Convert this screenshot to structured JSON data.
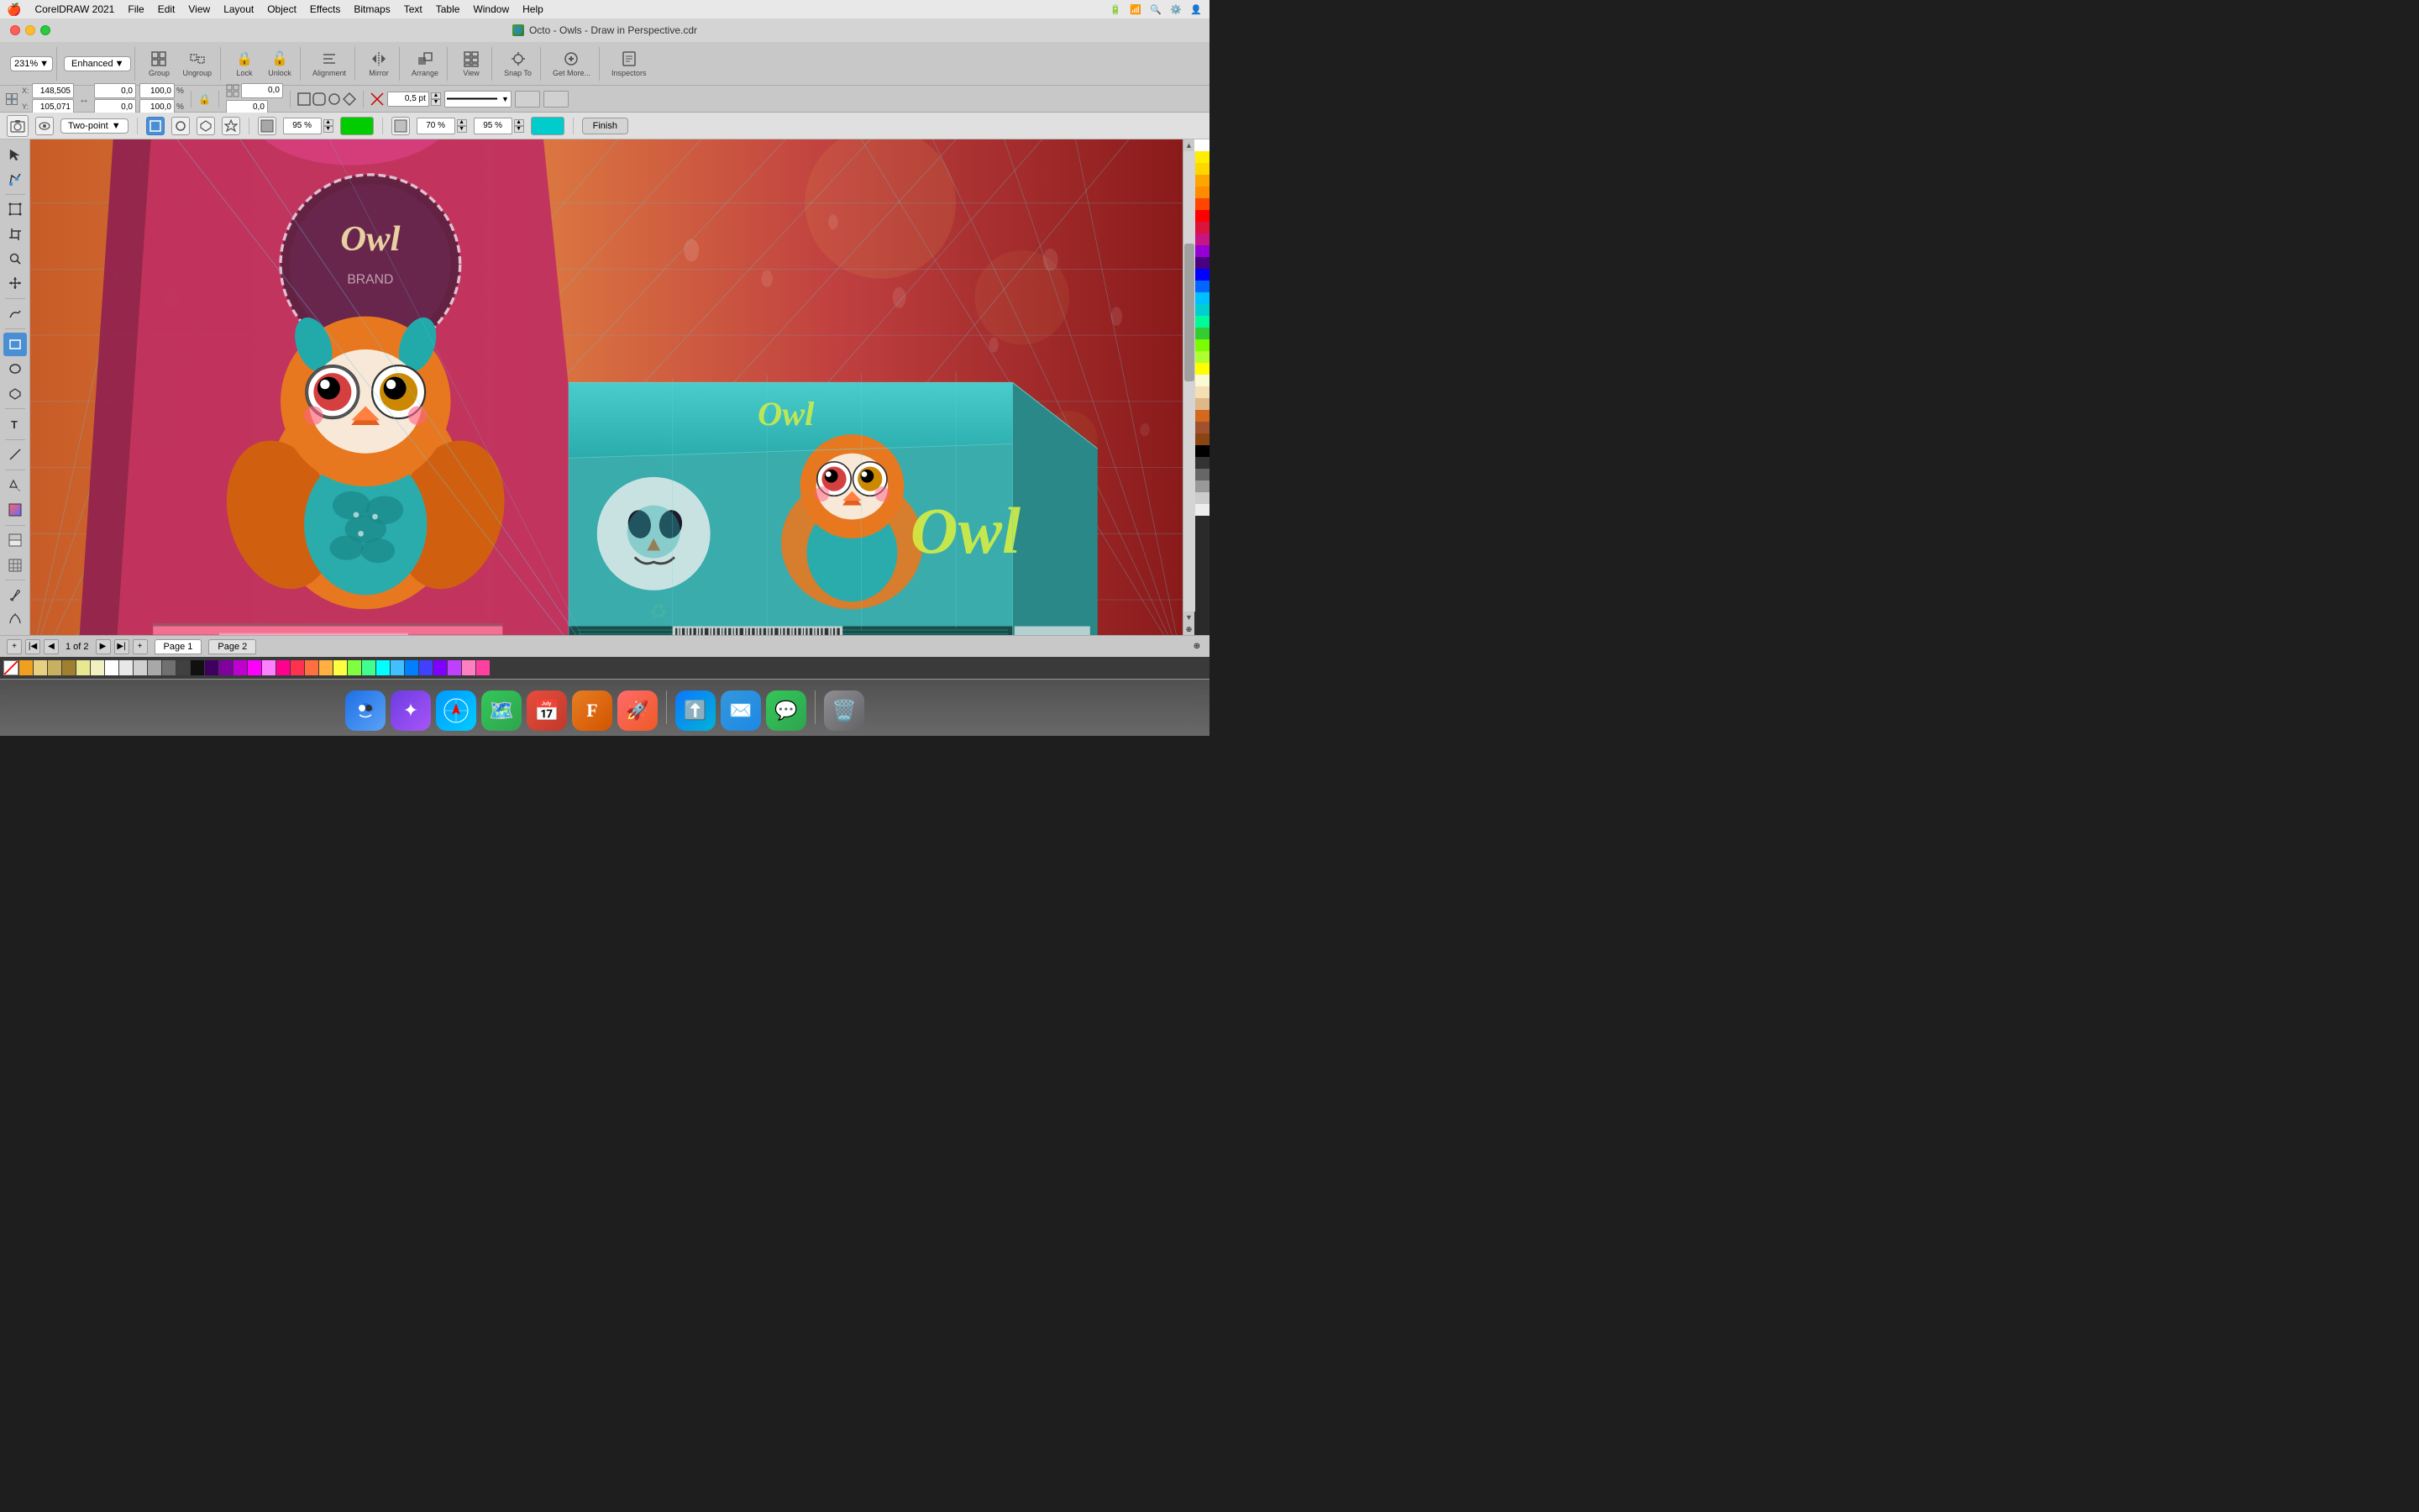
{
  "app": {
    "name": "CorelDRAW 2021",
    "title": "Octo - Owls - Draw in Perspective.cdr",
    "title_icon": "🦉"
  },
  "menubar": {
    "apple": "🍎",
    "items": [
      "CorelDRAW 2021",
      "File",
      "Edit",
      "View",
      "Layout",
      "Object",
      "Effects",
      "Bitmaps",
      "Text",
      "Table",
      "Window",
      "Help"
    ],
    "right_icons": [
      "battery",
      "wifi",
      "search",
      "control-center",
      "notification"
    ]
  },
  "toolbar": {
    "zoom_label": "231%",
    "view_mode_label": "Enhanced",
    "group_label": "Group",
    "ungroup_label": "Ungroup",
    "lock_label": "Lock",
    "unlock_label": "Unlock",
    "alignment_label": "Alignment",
    "mirror_label": "Mirror",
    "arrange_label": "Arrange",
    "view_label": "View",
    "snap_to_label": "Snap To",
    "get_more_label": "Get More...",
    "inspectors_label": "Inspectors"
  },
  "property_bar": {
    "x_value": "148,505",
    "y_value": "105,071",
    "x_label": "X:",
    "y_label": "Y:",
    "w_value": "0,0",
    "h_value": "0,0",
    "w_pct": "100,0",
    "h_pct": "100,0",
    "w_pct_sign": "%",
    "h_pct_sign": "%",
    "pos1": "0,0",
    "pos2": "0,0",
    "pos3": "0,0",
    "pos4": "0,0",
    "pos5": "0,0",
    "pos6": "0,0",
    "stroke_size": "0,5 pt",
    "angle": "0,0"
  },
  "perspective_bar": {
    "mode_label": "Two-point",
    "opacity1": "95 %",
    "opacity2": "70 %",
    "opacity3": "95 %",
    "finish_label": "Finish"
  },
  "canvas": {
    "background_color": "#c94040"
  },
  "status_bar": {
    "page_info": "1 of 2",
    "page1_label": "Page 1",
    "page2_label": "Page 2"
  },
  "color_palette": {
    "colors": [
      "#ffffff",
      "#ffee00",
      "#ffd700",
      "#ffa500",
      "#ff8c00",
      "#ff4500",
      "#ff0000",
      "#dc143c",
      "#c71585",
      "#9400d3",
      "#4b0082",
      "#0000ff",
      "#0066ff",
      "#00bfff",
      "#00ced1",
      "#00fa9a",
      "#32cd32",
      "#7cfc00",
      "#adff2f",
      "#ffff00",
      "#fafad2",
      "#f5deb3",
      "#deb887",
      "#d2691e",
      "#a0522d",
      "#8b4513",
      "#000000",
      "#333333",
      "#666666",
      "#999999",
      "#cccccc",
      "#eeeeee"
    ]
  },
  "bottom_colors": [
    "#f0a020",
    "#d4b060",
    "#c8a050",
    "#a06830",
    "#e0e0a0",
    "#f0f0d0",
    "#ffffff",
    "#e0e0e0",
    "#c0c0c0",
    "#909090",
    "#606060",
    "#303030",
    "#000000",
    "#400040",
    "#800080",
    "#c000c0",
    "#ff00ff",
    "#ff80ff",
    "#ff0080",
    "#ff4040",
    "#ff8040",
    "#ffc040",
    "#ffff40",
    "#80ff40",
    "#40ff80",
    "#00ffff",
    "#40c0ff",
    "#0080ff",
    "#4040ff",
    "#8000ff",
    "#c040ff"
  ],
  "dock": {
    "items": [
      {
        "name": "finder",
        "icon": "🔵",
        "color": "#1d6fe7"
      },
      {
        "name": "siri",
        "icon": "🔮",
        "color": "#9b59b6"
      },
      {
        "name": "safari",
        "icon": "🧭",
        "color": "#1a9af7"
      },
      {
        "name": "maps",
        "icon": "🗺️",
        "color": "#34c759"
      },
      {
        "name": "fantastical",
        "icon": "📅",
        "color": "#e74c3c"
      },
      {
        "name": "fontbook",
        "icon": "Ⓕ",
        "color": "#e67e22"
      },
      {
        "name": "launchpad",
        "icon": "🚀",
        "color": "#ff6b6b"
      },
      {
        "name": "appstore",
        "icon": "⬆️",
        "color": "#1778f2"
      },
      {
        "name": "mail",
        "icon": "✉️",
        "color": "#3498db"
      },
      {
        "name": "messages",
        "icon": "💬",
        "color": "#34c759"
      },
      {
        "name": "trash",
        "icon": "🗑️",
        "color": "#8e8e93"
      }
    ]
  }
}
